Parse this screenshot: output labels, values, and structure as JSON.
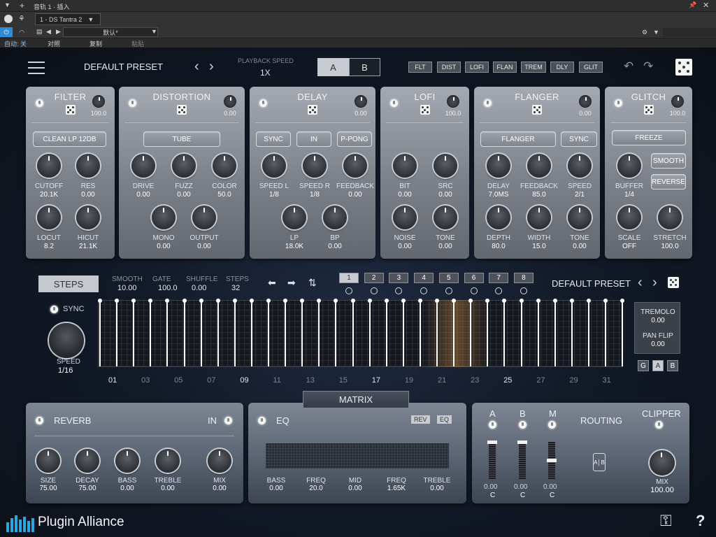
{
  "host": {
    "track_title": "音轨 1 · 插入",
    "preset_slot": "1 - DS Tantra 2",
    "default_label": "默认*",
    "auto_label": "自动: 关",
    "compare_label": "对照",
    "copy_label": "复制",
    "paste_label": "粘贴"
  },
  "header": {
    "preset_name": "DEFAULT PRESET",
    "playback_speed_label": "PLAYBACK SPEED",
    "playback_speed_value": "1X",
    "ab_a": "A",
    "ab_b": "B",
    "fx_buttons": [
      "FLT",
      "DIST",
      "LOFI",
      "FLAN",
      "TREM",
      "DLY",
      "GLIT"
    ]
  },
  "modules": {
    "filter": {
      "title": "FILTER",
      "mix": "100.0",
      "mode": "CLEAN LP 12DB",
      "knobs": [
        {
          "l": "CUTOFF",
          "v": "20.1K"
        },
        {
          "l": "RES",
          "v": "0.00"
        },
        {
          "l": "LOCUT",
          "v": "8.2"
        },
        {
          "l": "HICUT",
          "v": "21.1K"
        }
      ]
    },
    "distortion": {
      "title": "DISTORTION",
      "mix": "0.00",
      "mode": "TUBE",
      "knobs": [
        {
          "l": "DRIVE",
          "v": "0.00"
        },
        {
          "l": "FUZZ",
          "v": "0.00"
        },
        {
          "l": "COLOR",
          "v": "50.0"
        },
        {
          "l": "MONO",
          "v": "0.00"
        },
        {
          "l": "OUTPUT",
          "v": "0.00"
        }
      ]
    },
    "delay": {
      "title": "DELAY",
      "mix": "0.00",
      "btns": [
        "SYNC",
        "IN",
        "P-PONG"
      ],
      "knobs": [
        {
          "l": "SPEED L",
          "v": "1/8"
        },
        {
          "l": "SPEED R",
          "v": "1/8"
        },
        {
          "l": "FEEDBACK",
          "v": "0.00"
        },
        {
          "l": "LP",
          "v": "18.0K"
        },
        {
          "l": "BP",
          "v": "0.00"
        }
      ]
    },
    "lofi": {
      "title": "LOFI",
      "mix": "100.0",
      "knobs": [
        {
          "l": "BIT",
          "v": "0.00"
        },
        {
          "l": "SRC",
          "v": "0.00"
        },
        {
          "l": "NOISE",
          "v": "0.00"
        },
        {
          "l": "TONE",
          "v": "0.00"
        }
      ]
    },
    "flanger": {
      "title": "FLANGER",
      "mix": "0.00",
      "btns": [
        "FLANGER",
        "SYNC"
      ],
      "knobs": [
        {
          "l": "DELAY",
          "v": "7.0MS"
        },
        {
          "l": "FEEDBACK",
          "v": "85.0"
        },
        {
          "l": "SPEED",
          "v": "2/1"
        },
        {
          "l": "DEPTH",
          "v": "80.0"
        },
        {
          "l": "WIDTH",
          "v": "15.0"
        },
        {
          "l": "TONE",
          "v": "0.00"
        }
      ]
    },
    "glitch": {
      "title": "GLITCH",
      "mix": "100.0",
      "btns": [
        "FREEZE",
        "SMOOTH",
        "REVERSE"
      ],
      "knobs": [
        {
          "l": "BUFFER",
          "v": "1/4"
        },
        {
          "l": "SCALE",
          "v": "OFF"
        },
        {
          "l": "STRETCH",
          "v": "100.0"
        }
      ]
    }
  },
  "sequencer": {
    "steps_button": "STEPS",
    "params": [
      {
        "l": "SMOOTH",
        "v": "10.00"
      },
      {
        "l": "GATE",
        "v": "100.0"
      },
      {
        "l": "SHUFFLE",
        "v": "0.00"
      },
      {
        "l": "STEPS",
        "v": "32"
      }
    ],
    "pages": [
      "1",
      "2",
      "3",
      "4",
      "5",
      "6",
      "7",
      "8"
    ],
    "preset_name": "DEFAULT PRESET",
    "sync_label": "SYNC",
    "speed_label": "SPEED",
    "speed_value": "1/16",
    "step_numbers": [
      "01",
      "03",
      "05",
      "07",
      "09",
      "11",
      "13",
      "15",
      "17",
      "19",
      "21",
      "23",
      "25",
      "27",
      "29",
      "31"
    ],
    "tremolo_label": "TREMOLO",
    "tremolo_value": "0.00",
    "panflip_label": "PAN FLIP",
    "panflip_value": "0.00",
    "gab": [
      "G",
      "A",
      "B"
    ],
    "matrix_label": "MATRIX"
  },
  "reverb": {
    "title": "REVERB",
    "in_label": "IN",
    "knobs": [
      {
        "l": "SIZE",
        "v": "75.00"
      },
      {
        "l": "DECAY",
        "v": "75.00"
      },
      {
        "l": "BASS",
        "v": "0.00"
      },
      {
        "l": "TREBLE",
        "v": "0.00"
      },
      {
        "l": "MIX",
        "v": "0.00"
      }
    ]
  },
  "eq": {
    "title": "EQ",
    "rev": "REV",
    "eq": "EQ",
    "params": [
      {
        "l": "BASS",
        "v": "0.00"
      },
      {
        "l": "FREQ",
        "v": "20.0"
      },
      {
        "l": "MID",
        "v": "0.00"
      },
      {
        "l": "FREQ",
        "v": "1.65K"
      },
      {
        "l": "TREBLE",
        "v": "0.00"
      }
    ]
  },
  "routing": {
    "title": "ROUTING",
    "clipper": "CLIPPER",
    "channels": [
      {
        "l": "A",
        "v": "0.00",
        "p": "C"
      },
      {
        "l": "B",
        "v": "0.00",
        "p": "C"
      },
      {
        "l": "M",
        "v": "0.00",
        "p": "C"
      }
    ],
    "mix_label": "MIX",
    "mix_value": "100.00"
  },
  "footer": {
    "brand": "Plugin Alliance",
    "help": "?"
  },
  "colors": {
    "accent_orange": "#f0a34a",
    "panel_gray": "#8c9099"
  }
}
